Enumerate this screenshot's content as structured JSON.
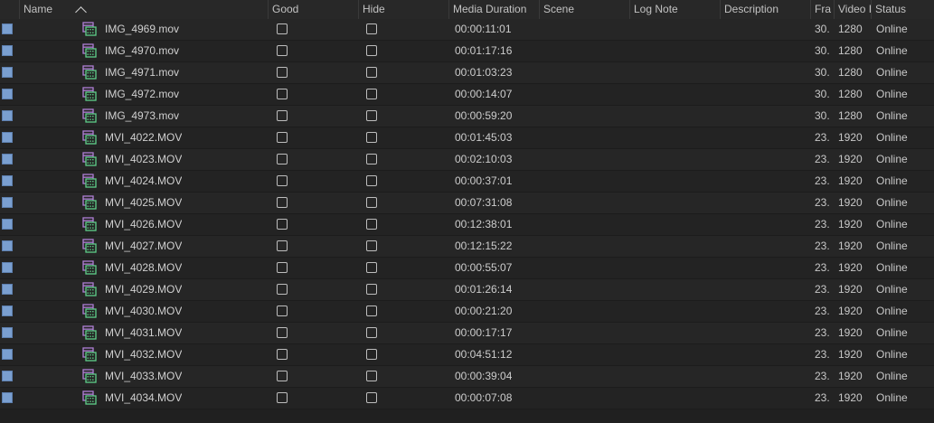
{
  "columns": {
    "name": "Name",
    "good": "Good",
    "hide": "Hide",
    "media_duration": "Media Duration",
    "scene": "Scene",
    "log_note": "Log Note",
    "description": "Description",
    "frame_rate": "Fra",
    "video_info": "Video I",
    "status": "Status"
  },
  "sort": {
    "column": "Name",
    "direction": "ascending"
  },
  "colors": {
    "label": "#7a9fd0",
    "clip_icon_frame": "#b07fd6",
    "clip_icon_film": "#5fd08a"
  },
  "rows": [
    {
      "name": "IMG_4969.mov",
      "good": false,
      "hide": false,
      "duration": "00:00:11:01",
      "scene": "",
      "log_note": "",
      "description": "",
      "frame_rate": "30.",
      "video": "1280",
      "status": "Online"
    },
    {
      "name": "IMG_4970.mov",
      "good": false,
      "hide": false,
      "duration": "00:01:17:16",
      "scene": "",
      "log_note": "",
      "description": "",
      "frame_rate": "30.",
      "video": "1280",
      "status": "Online"
    },
    {
      "name": "IMG_4971.mov",
      "good": false,
      "hide": false,
      "duration": "00:01:03:23",
      "scene": "",
      "log_note": "",
      "description": "",
      "frame_rate": "30.",
      "video": "1280",
      "status": "Online"
    },
    {
      "name": "IMG_4972.mov",
      "good": false,
      "hide": false,
      "duration": "00:00:14:07",
      "scene": "",
      "log_note": "",
      "description": "",
      "frame_rate": "30.",
      "video": "1280",
      "status": "Online"
    },
    {
      "name": "IMG_4973.mov",
      "good": false,
      "hide": false,
      "duration": "00:00:59:20",
      "scene": "",
      "log_note": "",
      "description": "",
      "frame_rate": "30.",
      "video": "1280",
      "status": "Online"
    },
    {
      "name": "MVI_4022.MOV",
      "good": false,
      "hide": false,
      "duration": "00:01:45:03",
      "scene": "",
      "log_note": "",
      "description": "",
      "frame_rate": "23.",
      "video": "1920",
      "status": "Online"
    },
    {
      "name": "MVI_4023.MOV",
      "good": false,
      "hide": false,
      "duration": "00:02:10:03",
      "scene": "",
      "log_note": "",
      "description": "",
      "frame_rate": "23.",
      "video": "1920",
      "status": "Online"
    },
    {
      "name": "MVI_4024.MOV",
      "good": false,
      "hide": false,
      "duration": "00:00:37:01",
      "scene": "",
      "log_note": "",
      "description": "",
      "frame_rate": "23.",
      "video": "1920",
      "status": "Online"
    },
    {
      "name": "MVI_4025.MOV",
      "good": false,
      "hide": false,
      "duration": "00:07:31:08",
      "scene": "",
      "log_note": "",
      "description": "",
      "frame_rate": "23.",
      "video": "1920",
      "status": "Online"
    },
    {
      "name": "MVI_4026.MOV",
      "good": false,
      "hide": false,
      "duration": "00:12:38:01",
      "scene": "",
      "log_note": "",
      "description": "",
      "frame_rate": "23.",
      "video": "1920",
      "status": "Online"
    },
    {
      "name": "MVI_4027.MOV",
      "good": false,
      "hide": false,
      "duration": "00:12:15:22",
      "scene": "",
      "log_note": "",
      "description": "",
      "frame_rate": "23.",
      "video": "1920",
      "status": "Online"
    },
    {
      "name": "MVI_4028.MOV",
      "good": false,
      "hide": false,
      "duration": "00:00:55:07",
      "scene": "",
      "log_note": "",
      "description": "",
      "frame_rate": "23.",
      "video": "1920",
      "status": "Online"
    },
    {
      "name": "MVI_4029.MOV",
      "good": false,
      "hide": false,
      "duration": "00:01:26:14",
      "scene": "",
      "log_note": "",
      "description": "",
      "frame_rate": "23.",
      "video": "1920",
      "status": "Online"
    },
    {
      "name": "MVI_4030.MOV",
      "good": false,
      "hide": false,
      "duration": "00:00:21:20",
      "scene": "",
      "log_note": "",
      "description": "",
      "frame_rate": "23.",
      "video": "1920",
      "status": "Online"
    },
    {
      "name": "MVI_4031.MOV",
      "good": false,
      "hide": false,
      "duration": "00:00:17:17",
      "scene": "",
      "log_note": "",
      "description": "",
      "frame_rate": "23.",
      "video": "1920",
      "status": "Online"
    },
    {
      "name": "MVI_4032.MOV",
      "good": false,
      "hide": false,
      "duration": "00:04:51:12",
      "scene": "",
      "log_note": "",
      "description": "",
      "frame_rate": "23.",
      "video": "1920",
      "status": "Online"
    },
    {
      "name": "MVI_4033.MOV",
      "good": false,
      "hide": false,
      "duration": "00:00:39:04",
      "scene": "",
      "log_note": "",
      "description": "",
      "frame_rate": "23.",
      "video": "1920",
      "status": "Online"
    },
    {
      "name": "MVI_4034.MOV",
      "good": false,
      "hide": false,
      "duration": "00:00:07:08",
      "scene": "",
      "log_note": "",
      "description": "",
      "frame_rate": "23.",
      "video": "1920",
      "status": "Online"
    }
  ]
}
